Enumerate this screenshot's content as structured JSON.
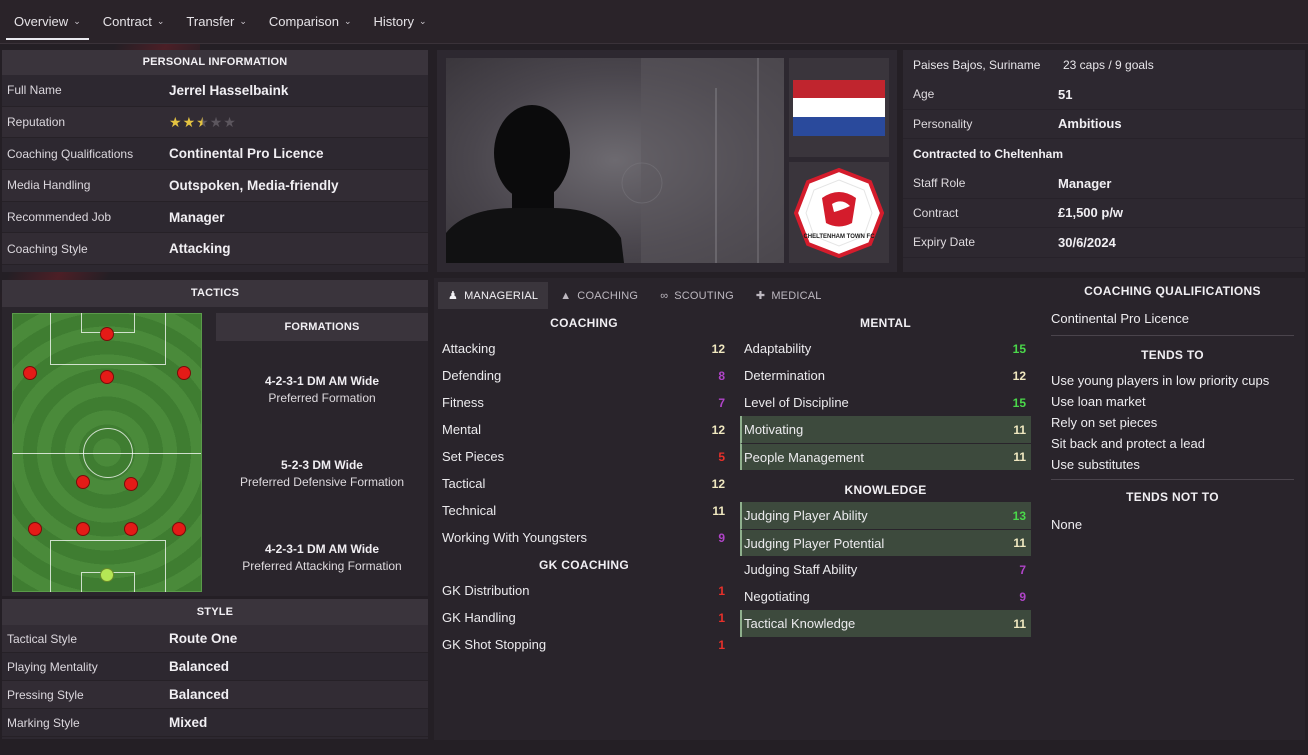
{
  "nav": {
    "tabs": [
      {
        "label": "Overview"
      },
      {
        "label": "Contract"
      },
      {
        "label": "Transfer"
      },
      {
        "label": "Comparison"
      },
      {
        "label": "History"
      }
    ]
  },
  "personal": {
    "header": "PERSONAL INFORMATION",
    "rows": [
      {
        "label": "Full Name",
        "value": "Jerrel Hasselbaink"
      },
      {
        "label": "Reputation",
        "value": "",
        "stars": 2.5
      },
      {
        "label": "Coaching Qualifications",
        "value": "Continental Pro Licence"
      },
      {
        "label": "Media Handling",
        "value": "Outspoken, Media-friendly"
      },
      {
        "label": "Recommended Job",
        "value": "Manager"
      },
      {
        "label": "Coaching Style",
        "value": "Attacking"
      }
    ]
  },
  "tactics": {
    "header": "TACTICS",
    "formations_header": "FORMATIONS",
    "formations": [
      {
        "name": "4-2-3-1 DM AM Wide",
        "sub": "Preferred Formation"
      },
      {
        "name": "5-2-3 DM Wide",
        "sub": "Preferred Defensive Formation"
      },
      {
        "name": "4-2-3-1 DM AM Wide",
        "sub": "Preferred Attacking Formation"
      }
    ]
  },
  "style": {
    "header": "STYLE",
    "rows": [
      {
        "label": "Tactical Style",
        "value": "Route One"
      },
      {
        "label": "Playing Mentality",
        "value": "Balanced"
      },
      {
        "label": "Pressing Style",
        "value": "Balanced"
      },
      {
        "label": "Marking Style",
        "value": "Mixed"
      }
    ]
  },
  "right_info": {
    "nationality": "Paises Bajos, Suriname",
    "caps": "23 caps / 9 goals",
    "rows1": [
      {
        "label": "Age",
        "value": "51"
      },
      {
        "label": "Personality",
        "value": "Ambitious"
      }
    ],
    "contracted": "Contracted to Cheltenham",
    "rows2": [
      {
        "label": "Staff Role",
        "value": "Manager"
      },
      {
        "label": "Contract",
        "value": "£1,500 p/w"
      },
      {
        "label": "Expiry Date",
        "value": "30/6/2024"
      }
    ],
    "club_badge_text": "CHELTENHAM TOWN FC"
  },
  "attr_tabs": [
    {
      "label": "MANAGERIAL"
    },
    {
      "label": "COACHING"
    },
    {
      "label": "SCOUTING"
    },
    {
      "label": "MEDICAL"
    }
  ],
  "coaching": {
    "header": "COACHING",
    "rows": [
      {
        "label": "Attacking",
        "value": "12",
        "color": "#f0e8c0"
      },
      {
        "label": "Defending",
        "value": "8",
        "color": "#b044c8"
      },
      {
        "label": "Fitness",
        "value": "7",
        "color": "#b044c8"
      },
      {
        "label": "Mental",
        "value": "12",
        "color": "#f0e8c0"
      },
      {
        "label": "Set Pieces",
        "value": "5",
        "color": "#e8302a"
      },
      {
        "label": "Tactical",
        "value": "12",
        "color": "#f0e8c0"
      },
      {
        "label": "Technical",
        "value": "11",
        "color": "#f0e8c0"
      },
      {
        "label": "Working With Youngsters",
        "value": "9",
        "color": "#b044c8"
      }
    ]
  },
  "gk_coaching": {
    "header": "GK COACHING",
    "rows": [
      {
        "label": "GK Distribution",
        "value": "1",
        "color": "#e8302a"
      },
      {
        "label": "GK Handling",
        "value": "1",
        "color": "#e8302a"
      },
      {
        "label": "GK Shot Stopping",
        "value": "1",
        "color": "#e8302a"
      }
    ]
  },
  "mental": {
    "header": "MENTAL",
    "rows": [
      {
        "label": "Adaptability",
        "value": "15",
        "color": "#4ad84a"
      },
      {
        "label": "Determination",
        "value": "12",
        "color": "#f0e8c0"
      },
      {
        "label": "Level of Discipline",
        "value": "15",
        "color": "#4ad84a"
      },
      {
        "label": "Motivating",
        "value": "11",
        "color": "#f0e8c0"
      },
      {
        "label": "People Management",
        "value": "11",
        "color": "#f0e8c0"
      }
    ]
  },
  "knowledge": {
    "header": "KNOWLEDGE",
    "rows": [
      {
        "label": "Judging Player Ability",
        "value": "13",
        "color": "#4ad84a"
      },
      {
        "label": "Judging Player Potential",
        "value": "11",
        "color": "#f0e8c0"
      },
      {
        "label": "Judging Staff Ability",
        "value": "7",
        "color": "#b044c8"
      },
      {
        "label": "Negotiating",
        "value": "9",
        "color": "#b044c8"
      },
      {
        "label": "Tactical Knowledge",
        "value": "11",
        "color": "#f0e8c0"
      }
    ]
  },
  "right_col": {
    "qual_header": "COACHING QUALIFICATIONS",
    "qual_value": "Continental Pro Licence",
    "tends_to_header": "TENDS TO",
    "tends_to": [
      "Use young players in low priority cups",
      "Use loan market",
      "Rely on set pieces",
      "Sit back and protect a lead",
      "Use substitutes"
    ],
    "tends_not_header": "TENDS NOT TO",
    "tends_not": "None"
  }
}
